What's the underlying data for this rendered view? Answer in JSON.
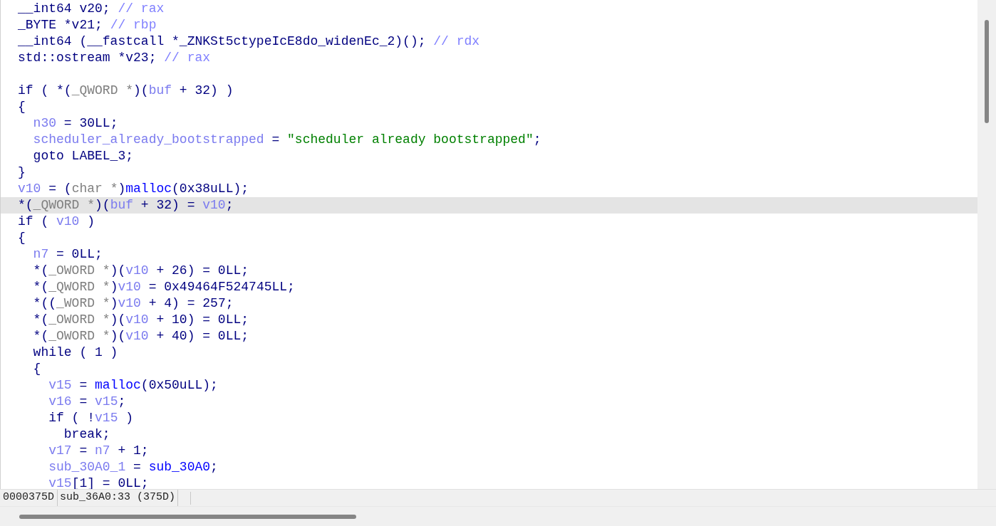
{
  "code_view": {
    "lines": [
      {
        "kind": "code",
        "selected": false,
        "tokens": [
          {
            "kind": "plain",
            "text": "__int64 v20; "
          },
          {
            "kind": "comment",
            "text": "// rax"
          }
        ]
      },
      {
        "kind": "code",
        "selected": false,
        "tokens": [
          {
            "kind": "plain",
            "text": "_BYTE *v21; "
          },
          {
            "kind": "comment",
            "text": "// rbp"
          }
        ]
      },
      {
        "kind": "code",
        "selected": false,
        "tokens": [
          {
            "kind": "plain",
            "text": "__int64 (__fastcall *_ZNKSt5ctypeIcE8do_widenEc_2)(); "
          },
          {
            "kind": "comment",
            "text": "// rdx"
          }
        ]
      },
      {
        "kind": "code",
        "selected": false,
        "tokens": [
          {
            "kind": "plain",
            "text": "std::ostream *v23; "
          },
          {
            "kind": "comment",
            "text": "// rax"
          }
        ]
      },
      {
        "kind": "blank",
        "selected": false
      },
      {
        "kind": "code",
        "selected": false,
        "tokens": [
          {
            "kind": "plain",
            "text": "if ( *("
          },
          {
            "kind": "type",
            "text": "_QWORD *"
          },
          {
            "kind": "plain",
            "text": ")("
          },
          {
            "kind": "var",
            "text": "buf"
          },
          {
            "kind": "plain",
            "text": " + 32) )"
          }
        ]
      },
      {
        "kind": "code",
        "selected": false,
        "tokens": [
          {
            "kind": "plain",
            "text": "{"
          }
        ]
      },
      {
        "kind": "code",
        "selected": false,
        "tokens": [
          {
            "kind": "var",
            "text": "  n30"
          },
          {
            "kind": "plain",
            "text": " = 30LL;"
          }
        ]
      },
      {
        "kind": "code",
        "selected": false,
        "tokens": [
          {
            "kind": "var",
            "text": "  scheduler_already_bootstrapped"
          },
          {
            "kind": "plain",
            "text": " = "
          },
          {
            "kind": "string",
            "text": "\"scheduler already bootstrapped\""
          },
          {
            "kind": "plain",
            "text": ";"
          }
        ]
      },
      {
        "kind": "code",
        "selected": false,
        "tokens": [
          {
            "kind": "plain",
            "text": "  goto LABEL_3;"
          }
        ]
      },
      {
        "kind": "code",
        "selected": false,
        "tokens": [
          {
            "kind": "plain",
            "text": "}"
          }
        ]
      },
      {
        "kind": "code",
        "selected": false,
        "tokens": [
          {
            "kind": "var",
            "text": "v10"
          },
          {
            "kind": "plain",
            "text": " = ("
          },
          {
            "kind": "type",
            "text": "char *"
          },
          {
            "kind": "plain",
            "text": ")"
          },
          {
            "kind": "func",
            "text": "malloc"
          },
          {
            "kind": "plain",
            "text": "(0x38uLL);"
          }
        ]
      },
      {
        "kind": "code",
        "selected": true,
        "tokens": [
          {
            "kind": "plain",
            "text": "*("
          },
          {
            "kind": "type",
            "text": "_QWORD *"
          },
          {
            "kind": "plain",
            "text": ")("
          },
          {
            "kind": "var",
            "text": "buf"
          },
          {
            "kind": "plain",
            "text": " + 32) = "
          },
          {
            "kind": "var",
            "text": "v10"
          },
          {
            "kind": "plain",
            "text": ";"
          }
        ]
      },
      {
        "kind": "code",
        "selected": false,
        "tokens": [
          {
            "kind": "plain",
            "text": "if ( "
          },
          {
            "kind": "var",
            "text": "v10"
          },
          {
            "kind": "plain",
            "text": " )"
          }
        ]
      },
      {
        "kind": "code",
        "selected": false,
        "tokens": [
          {
            "kind": "plain",
            "text": "{"
          }
        ]
      },
      {
        "kind": "code",
        "selected": false,
        "tokens": [
          {
            "kind": "var",
            "text": "  n7"
          },
          {
            "kind": "plain",
            "text": " = 0LL;"
          }
        ]
      },
      {
        "kind": "code",
        "selected": false,
        "tokens": [
          {
            "kind": "plain",
            "text": "  *("
          },
          {
            "kind": "type",
            "text": "_OWORD *"
          },
          {
            "kind": "plain",
            "text": ")("
          },
          {
            "kind": "var",
            "text": "v10"
          },
          {
            "kind": "plain",
            "text": " + 26) = 0LL;"
          }
        ]
      },
      {
        "kind": "code",
        "selected": false,
        "tokens": [
          {
            "kind": "plain",
            "text": "  *("
          },
          {
            "kind": "type",
            "text": "_QWORD *"
          },
          {
            "kind": "plain",
            "text": ")"
          },
          {
            "kind": "var",
            "text": "v10"
          },
          {
            "kind": "plain",
            "text": " = 0x49464F524745LL;"
          }
        ]
      },
      {
        "kind": "code",
        "selected": false,
        "tokens": [
          {
            "kind": "plain",
            "text": "  *(("
          },
          {
            "kind": "type",
            "text": "_WORD *"
          },
          {
            "kind": "plain",
            "text": ")"
          },
          {
            "kind": "var",
            "text": "v10"
          },
          {
            "kind": "plain",
            "text": " + 4) = 257;"
          }
        ]
      },
      {
        "kind": "code",
        "selected": false,
        "tokens": [
          {
            "kind": "plain",
            "text": "  *("
          },
          {
            "kind": "type",
            "text": "_OWORD *"
          },
          {
            "kind": "plain",
            "text": ")("
          },
          {
            "kind": "var",
            "text": "v10"
          },
          {
            "kind": "plain",
            "text": " + 10) = 0LL;"
          }
        ]
      },
      {
        "kind": "code",
        "selected": false,
        "tokens": [
          {
            "kind": "plain",
            "text": "  *("
          },
          {
            "kind": "type",
            "text": "_OWORD *"
          },
          {
            "kind": "plain",
            "text": ")("
          },
          {
            "kind": "var",
            "text": "v10"
          },
          {
            "kind": "plain",
            "text": " + 40) = 0LL;"
          }
        ]
      },
      {
        "kind": "code",
        "selected": false,
        "tokens": [
          {
            "kind": "plain",
            "text": "  while ( 1 )"
          }
        ]
      },
      {
        "kind": "code",
        "selected": false,
        "tokens": [
          {
            "kind": "plain",
            "text": "  {"
          }
        ]
      },
      {
        "kind": "code",
        "selected": false,
        "tokens": [
          {
            "kind": "var",
            "text": "    v15"
          },
          {
            "kind": "plain",
            "text": " = "
          },
          {
            "kind": "func",
            "text": "malloc"
          },
          {
            "kind": "plain",
            "text": "(0x50uLL);"
          }
        ]
      },
      {
        "kind": "code",
        "selected": false,
        "tokens": [
          {
            "kind": "var",
            "text": "    v16"
          },
          {
            "kind": "plain",
            "text": " = "
          },
          {
            "kind": "var",
            "text": "v15"
          },
          {
            "kind": "plain",
            "text": ";"
          }
        ]
      },
      {
        "kind": "code",
        "selected": false,
        "tokens": [
          {
            "kind": "plain",
            "text": "    if ( !"
          },
          {
            "kind": "var",
            "text": "v15"
          },
          {
            "kind": "plain",
            "text": " )"
          }
        ]
      },
      {
        "kind": "code",
        "selected": false,
        "tokens": [
          {
            "kind": "plain",
            "text": "      break;"
          }
        ]
      },
      {
        "kind": "code",
        "selected": false,
        "tokens": [
          {
            "kind": "var",
            "text": "    v17"
          },
          {
            "kind": "plain",
            "text": " = "
          },
          {
            "kind": "var",
            "text": "n7"
          },
          {
            "kind": "plain",
            "text": " + 1;"
          }
        ]
      },
      {
        "kind": "code",
        "selected": false,
        "tokens": [
          {
            "kind": "var",
            "text": "    sub_30A0_1"
          },
          {
            "kind": "plain",
            "text": " = "
          },
          {
            "kind": "func",
            "text": "sub_30A0"
          },
          {
            "kind": "plain",
            "text": ";"
          }
        ]
      },
      {
        "kind": "code",
        "selected": false,
        "tokens": [
          {
            "kind": "var",
            "text": "    v15"
          },
          {
            "kind": "plain",
            "text": "[1] = 0LL;"
          }
        ]
      }
    ]
  },
  "status_bar": {
    "address": "0000375D",
    "location": "sub_36A0:33 (375D)"
  }
}
